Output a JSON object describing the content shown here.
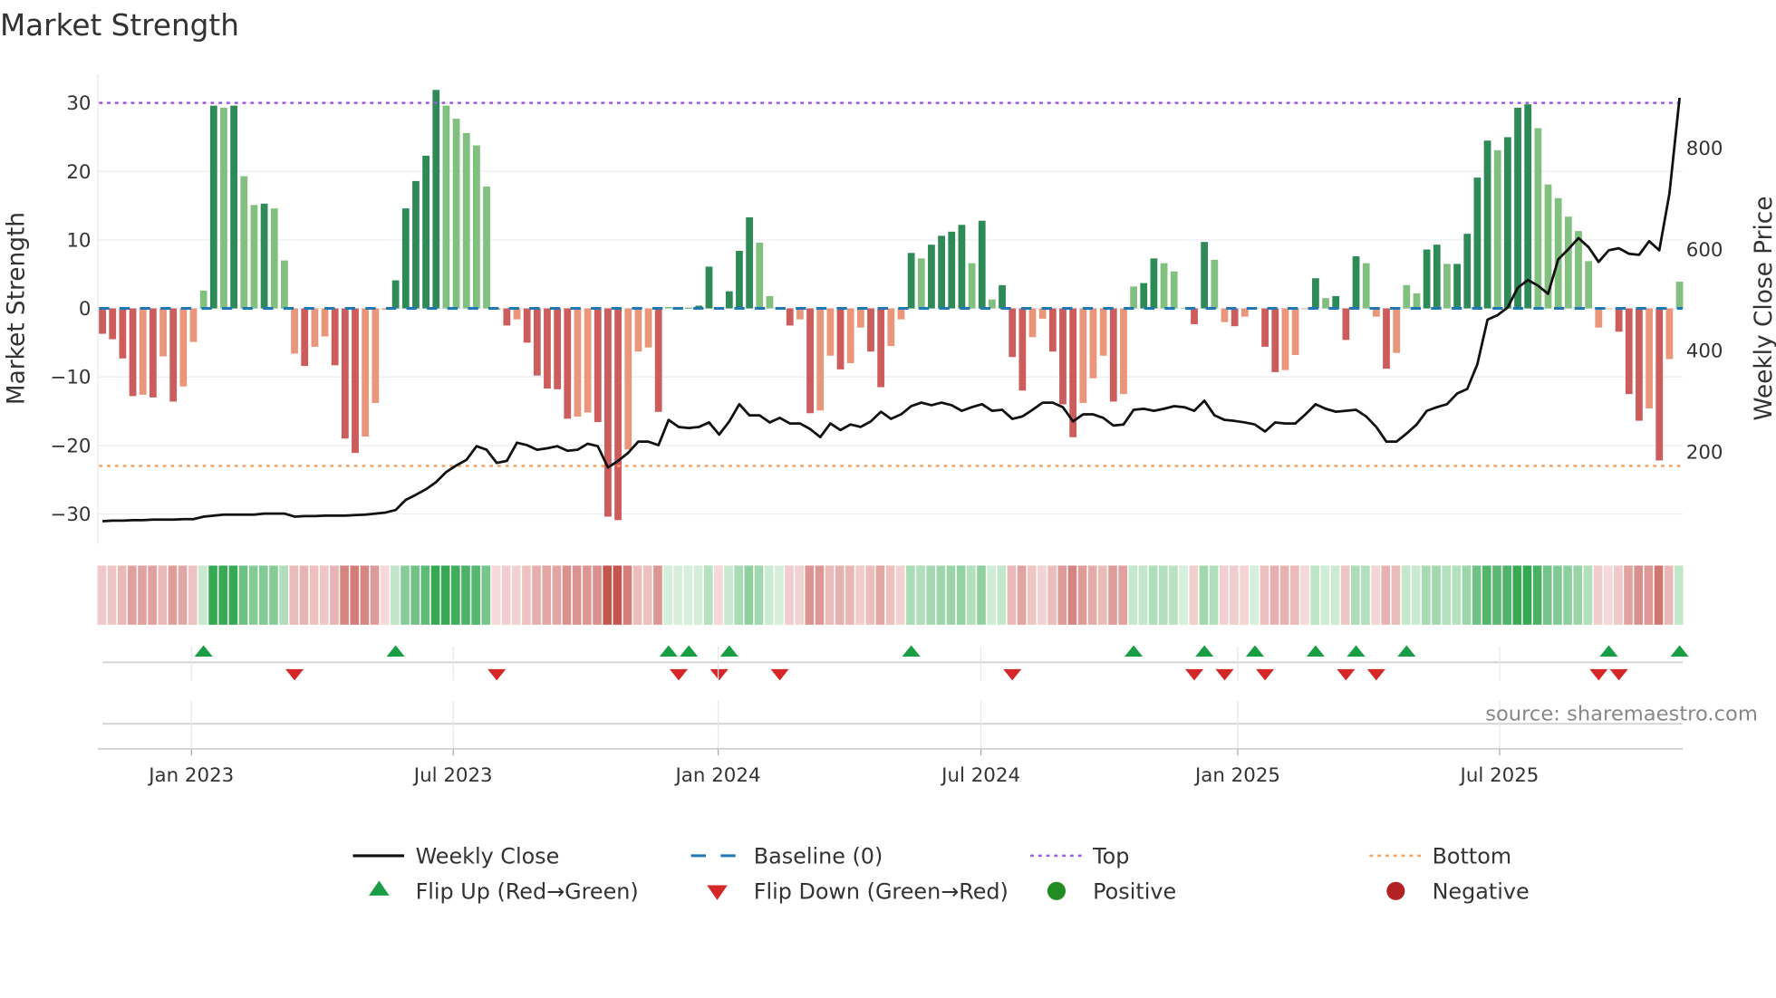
{
  "chart_data": {
    "type": "bar",
    "title": "Market Strength",
    "ylabel": "Market Strength",
    "y2label": "Weekly Close Price",
    "ylim": [
      -34,
      35
    ],
    "y2lim": [
      40,
      920
    ],
    "yticks": [
      "30",
      "20",
      "10",
      "0",
      "−10",
      "−20",
      "−30"
    ],
    "ytick_values": [
      30,
      20,
      10,
      0,
      -10,
      -20,
      -30
    ],
    "y2ticks": [
      "800",
      "600",
      "400",
      "200"
    ],
    "y2tick_values": [
      800,
      600,
      400,
      200
    ],
    "top_level": 30,
    "bottom_level": -23,
    "x_ticks": [
      {
        "label": "Jan 2023",
        "week": 9.8
      },
      {
        "label": "Jul 2023",
        "week": 35.7
      },
      {
        "label": "Jan 2024",
        "week": 61.9
      },
      {
        "label": "Jul 2024",
        "week": 87.9
      },
      {
        "label": "Jan 2025",
        "week": 113.3
      },
      {
        "label": "Jul 2025",
        "week": 139.2
      }
    ],
    "strength": [
      -3.7,
      -4.5,
      -7.3,
      -12.8,
      -12.6,
      -13,
      -7,
      -13.6,
      -11.4,
      -4.9,
      2.6,
      29.6,
      29.3,
      29.6,
      19.3,
      15.1,
      15.3,
      14.6,
      7.0,
      -6.6,
      -8.4,
      -5.6,
      -4.1,
      -8.3,
      -19,
      -21.1,
      -18.7,
      -13.8,
      -0.2,
      4.1,
      14.6,
      18.6,
      22.3,
      31.9,
      29.6,
      27.7,
      25.6,
      23.8,
      17.8,
      -0.2,
      -2.5,
      -1.6,
      -5.0,
      -9.8,
      -11.7,
      -11.8,
      -16.1,
      -15.8,
      -15.2,
      -16.6,
      -30.4,
      -30.9,
      -20.6,
      -6.3,
      -5.7,
      -15.1,
      0.2,
      0.1,
      0.1,
      0.4,
      6.1,
      -0.2,
      2.5,
      8.4,
      13.3,
      9.6,
      1.8,
      0.1,
      -2.5,
      -1.6,
      -15.3,
      -14.9,
      -6.9,
      -8.9,
      -8,
      -2.8,
      -6.3,
      -11.5,
      -5.5,
      -1.6,
      8.1,
      7.3,
      9.3,
      10.6,
      11.2,
      12.2,
      6.6,
      12.8,
      1.3,
      3.4,
      -7.1,
      -12,
      -4.2,
      -1.5,
      -6.3,
      -14,
      -18.8,
      -13.8,
      -10.2,
      -6.9,
      -13.6,
      -12.5,
      3.2,
      3.7,
      7.3,
      6.6,
      5.4,
      0.1,
      -2.3,
      9.7,
      7.1,
      -2,
      -2.6,
      -1.2,
      0.1,
      -5.6,
      -9.3,
      -9,
      -6.8,
      -0.1,
      4.4,
      1.5,
      1.8,
      -4.6,
      7.6,
      6.6,
      -1.2,
      -8.8,
      -6.5,
      3.4,
      2.2,
      8.6,
      9.3,
      6.5,
      6.5,
      10.9,
      19.1,
      24.5,
      23.1,
      25,
      29.3,
      29.8,
      26.3,
      18.1,
      16.1,
      13.4,
      11.3,
      6.9,
      -2.8,
      -0.1,
      -3.4,
      -12.5,
      -16.4,
      -14.6,
      -22.2,
      -7.4,
      3.9
    ],
    "weekly_close": [
      63,
      64,
      64,
      65,
      65,
      66,
      66,
      66,
      67,
      67,
      72,
      74,
      76,
      76,
      76,
      76,
      78,
      78,
      78,
      72,
      73,
      73,
      74,
      74,
      74,
      75,
      76,
      78,
      80,
      85,
      105,
      115,
      126,
      140,
      160,
      173,
      184,
      211,
      204,
      178,
      182,
      218,
      213,
      204,
      207,
      211,
      202,
      204,
      216,
      211,
      169,
      182,
      198,
      220,
      220,
      213,
      263,
      249,
      247,
      249,
      258,
      234,
      260,
      294,
      272,
      272,
      258,
      267,
      256,
      256,
      245,
      229,
      256,
      243,
      254,
      249,
      260,
      279,
      265,
      274,
      290,
      297,
      292,
      297,
      292,
      281,
      288,
      294,
      281,
      283,
      265,
      270,
      283,
      297,
      297,
      288,
      260,
      274,
      274,
      267,
      252,
      254,
      283,
      285,
      281,
      285,
      290,
      288,
      281,
      301,
      272,
      263,
      261,
      258,
      254,
      240,
      258,
      256,
      256,
      274,
      294,
      285,
      279,
      281,
      283,
      270,
      249,
      220,
      220,
      236,
      254,
      281,
      288,
      294,
      315,
      324,
      373,
      461,
      470,
      485,
      524,
      539,
      528,
      512,
      580,
      600,
      622,
      604,
      575,
      598,
      602,
      591,
      589,
      616,
      598,
      710,
      899
    ],
    "flip_up_weeks": [
      11,
      30,
      57,
      59,
      63,
      81,
      103,
      110,
      115,
      121,
      125,
      130,
      150,
      157
    ],
    "flip_down_weeks": [
      20,
      40,
      58,
      62,
      68,
      91,
      109,
      112,
      116,
      124,
      127,
      149,
      151
    ],
    "legend": [
      {
        "label": "Weekly Close",
        "kind": "line"
      },
      {
        "label": "Baseline (0)",
        "kind": "dash"
      },
      {
        "label": "Top",
        "kind": "dot-top"
      },
      {
        "label": "Bottom",
        "kind": "dot-bottom"
      },
      {
        "label": "Flip Up (Red→Green)",
        "kind": "tri-up"
      },
      {
        "label": "Flip Down (Green→Red)",
        "kind": "tri-down"
      },
      {
        "label": "Positive",
        "kind": "circle-pos"
      },
      {
        "label": "Negative",
        "kind": "circle-neg"
      }
    ],
    "source": "source: sharemaestro.com",
    "colors": {
      "pos_dark": "#2e8b57",
      "pos_light": "#82c07f",
      "neg_dark": "#cd5c5c",
      "neg_light": "#e9967a",
      "baseline": "#1f77b4",
      "top": "#9b59e0",
      "bottom": "#f4a460",
      "line": "#111111",
      "flip_up": "#1a9e45",
      "flip_down": "#d62728",
      "positive": "#228b22",
      "negative": "#b22222"
    }
  }
}
